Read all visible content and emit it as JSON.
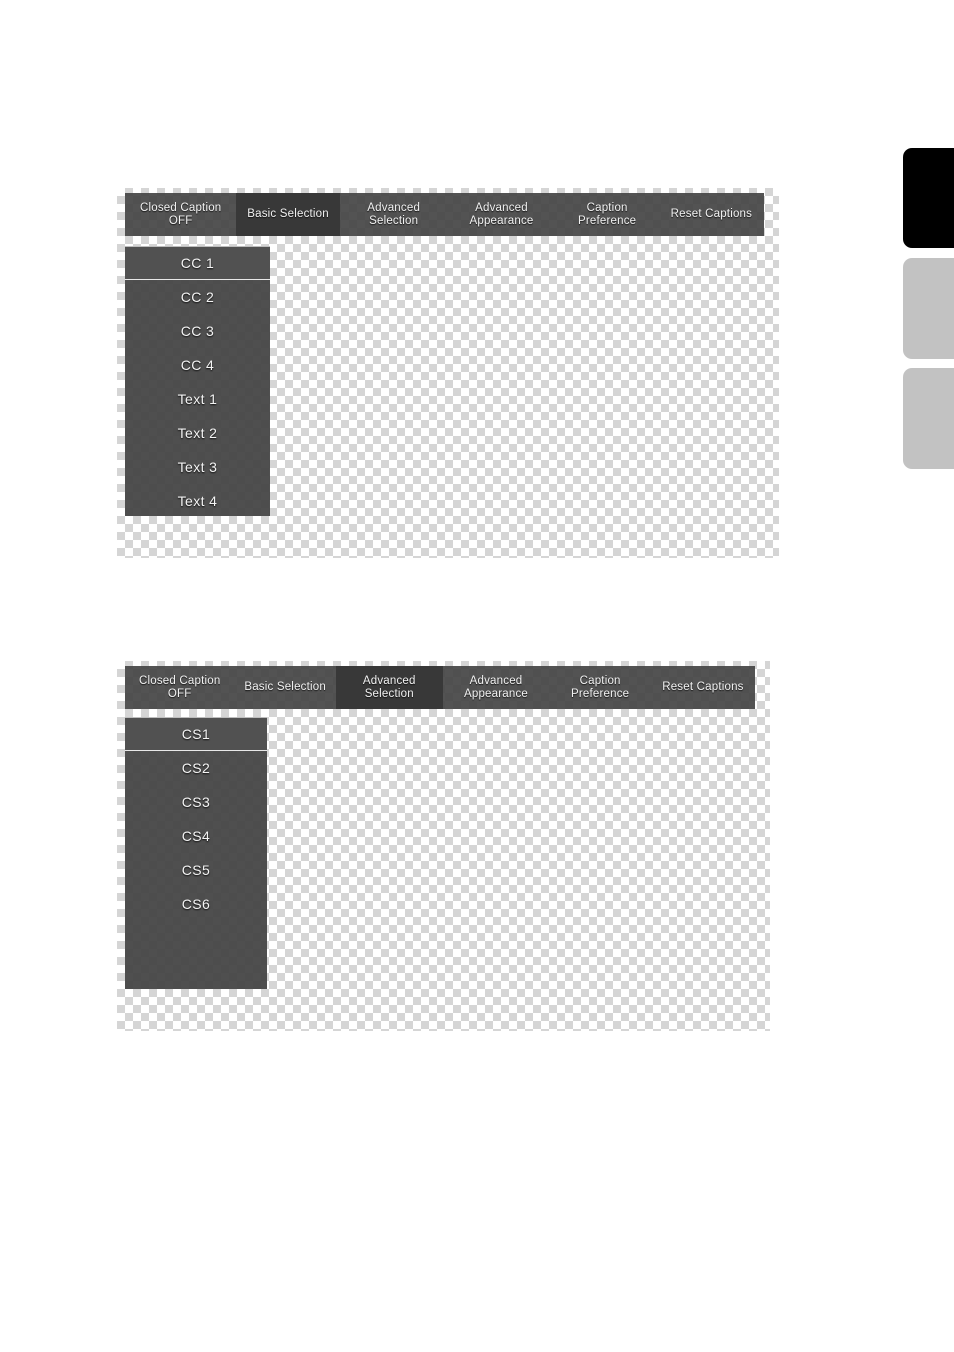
{
  "page": {
    "background_color": "#ffffff",
    "panel_chrome_color": "#464646",
    "active_tab_color": "#383838",
    "list_background_color": "#444444",
    "selected_item_color": "#525252",
    "text_color": "#f2f2f2"
  },
  "edge_tabs": [
    {
      "name": "edge-tab-black",
      "color": "#000000"
    },
    {
      "name": "edge-tab-gray-1",
      "color": "#c2c2c2"
    },
    {
      "name": "edge-tab-gray-2",
      "color": "#c2c2c2"
    }
  ],
  "screens": [
    {
      "id": "basic-selection-screen",
      "tabs": [
        {
          "key": "closed-caption-off",
          "label": "Closed Caption\nOFF",
          "active": false
        },
        {
          "key": "basic-selection",
          "label": "Basic Selection",
          "active": true
        },
        {
          "key": "advanced-selection",
          "label": "Advanced\nSelection",
          "active": false
        },
        {
          "key": "advanced-appearance",
          "label": "Advanced\nAppearance",
          "active": false
        },
        {
          "key": "caption-preference",
          "label": "Caption\nPreference",
          "active": false
        },
        {
          "key": "reset-captions",
          "label": "Reset Captions",
          "active": false
        }
      ],
      "options": [
        {
          "key": "cc-1",
          "label": "CC 1",
          "selected": true
        },
        {
          "key": "cc-2",
          "label": "CC 2",
          "selected": false
        },
        {
          "key": "cc-3",
          "label": "CC 3",
          "selected": false
        },
        {
          "key": "cc-4",
          "label": "CC 4",
          "selected": false
        },
        {
          "key": "text-1",
          "label": "Text 1",
          "selected": false
        },
        {
          "key": "text-2",
          "label": "Text 2",
          "selected": false
        },
        {
          "key": "text-3",
          "label": "Text 3",
          "selected": false
        },
        {
          "key": "text-4",
          "label": "Text 4",
          "selected": false
        }
      ]
    },
    {
      "id": "advanced-selection-screen",
      "tabs": [
        {
          "key": "closed-caption-off",
          "label": "Closed Caption\nOFF",
          "active": false
        },
        {
          "key": "basic-selection",
          "label": "Basic Selection",
          "active": false
        },
        {
          "key": "advanced-selection",
          "label": "Advanced\nSelection",
          "active": true
        },
        {
          "key": "advanced-appearance",
          "label": "Advanced\nAppearance",
          "active": false
        },
        {
          "key": "caption-preference",
          "label": "Caption\nPreference",
          "active": false
        },
        {
          "key": "reset-captions",
          "label": "Reset Captions",
          "active": false
        }
      ],
      "options": [
        {
          "key": "cs1",
          "label": "CS1",
          "selected": true
        },
        {
          "key": "cs2",
          "label": "CS2",
          "selected": false
        },
        {
          "key": "cs3",
          "label": "CS3",
          "selected": false
        },
        {
          "key": "cs4",
          "label": "CS4",
          "selected": false
        },
        {
          "key": "cs5",
          "label": "CS5",
          "selected": false
        },
        {
          "key": "cs6",
          "label": "CS6",
          "selected": false
        }
      ]
    }
  ]
}
